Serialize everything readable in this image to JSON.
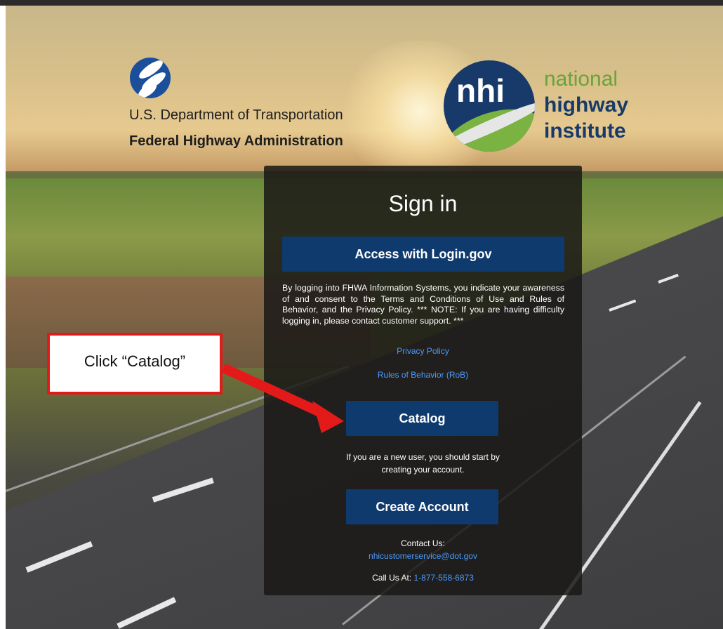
{
  "header": {
    "dot_line1": "U.S. Department of Transportation",
    "dot_line2": "Federal Highway Administration",
    "nhi_letters": "nhi",
    "nhi_word1": "national",
    "nhi_word2": "highway",
    "nhi_word3": "institute"
  },
  "signin": {
    "title": "Sign in",
    "login_button": "Access with Login.gov",
    "notice": "By logging into FHWA Information Systems, you indicate your awareness of and consent to the Terms and Conditions of Use and Rules of Behavior, and the Privacy Policy. *** NOTE: If you are having difficulty logging in, please contact customer support. ***",
    "privacy_link": "Privacy Policy",
    "rob_link": "Rules of Behavior (RoB)",
    "catalog_button": "Catalog",
    "new_user_text": "If you are a new user, you should start by creating your account.",
    "create_button": "Create Account",
    "contact_label": "Contact Us:",
    "contact_email": "nhicustomerservice@dot.gov",
    "call_label": "Call Us At:",
    "call_number": "1-877-558-6873"
  },
  "annotation": {
    "callout_text": "Click “Catalog”",
    "color": "#e41a1a"
  },
  "colors": {
    "button_bg": "#0f3a6e",
    "link": "#4a9bff",
    "dot_blue": "#1b4f9c",
    "nhi_navy": "#173a6b",
    "nhi_green": "#6aa33a"
  }
}
